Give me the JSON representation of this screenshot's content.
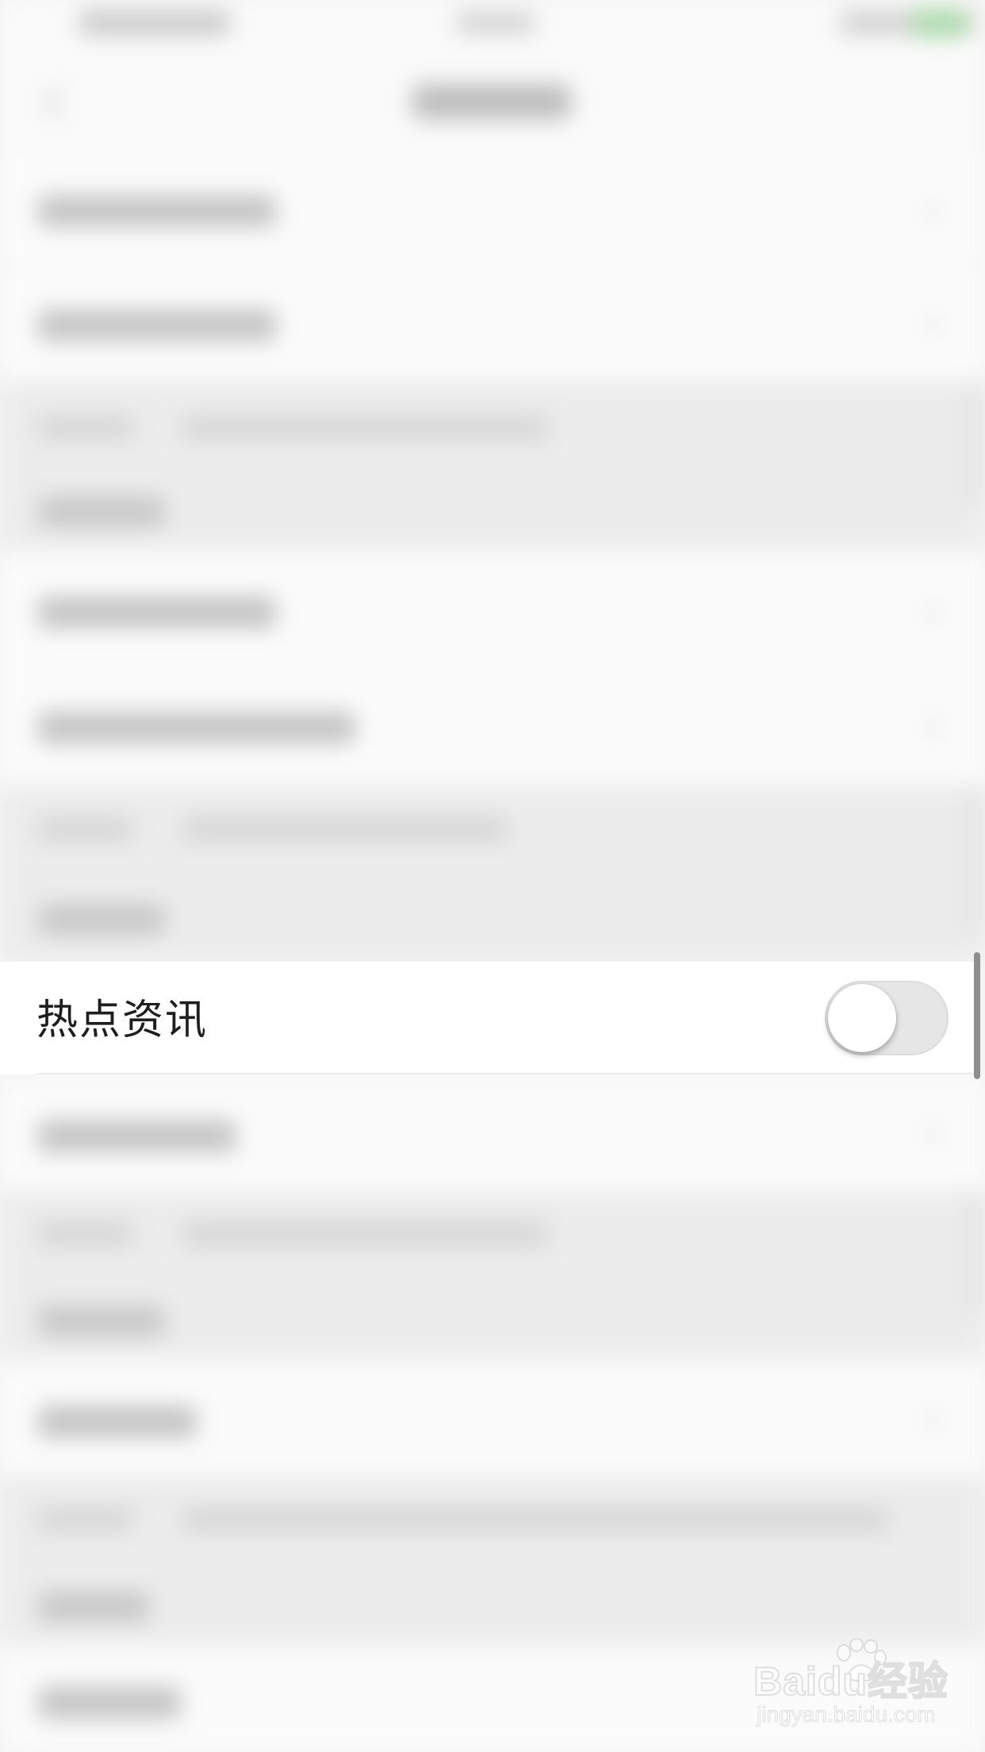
{
  "row": {
    "label": "热点资讯",
    "toggle_on": false
  },
  "watermark": {
    "logo_text": "Baidu经验",
    "url": "jingyan.baidu.com"
  },
  "colors": {
    "background": "#f4f4f4",
    "row_background": "#ffffff",
    "label_text": "#1e1e1e",
    "toggle_off_track": "#e6e6e6",
    "status_battery": "#a9d8a9"
  },
  "icons": {
    "nav_back": "chevron-left-icon",
    "row_chevron": "chevron-right-icon"
  }
}
